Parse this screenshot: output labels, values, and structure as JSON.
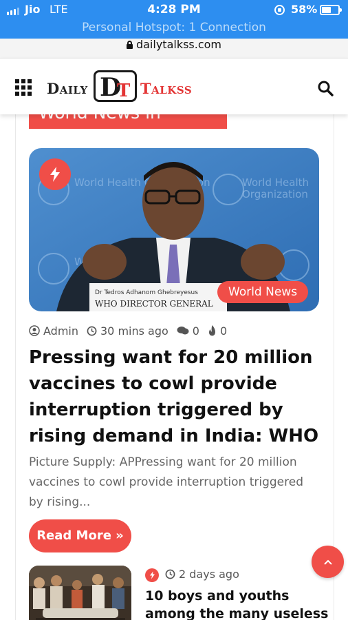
{
  "status_bar": {
    "carrier": "Jio",
    "network": "LTE",
    "time": "4:28 PM",
    "battery_percent": "58%",
    "battery_level": 0.58,
    "hotspot_text": "Personal Hotspot: 1 Connection"
  },
  "browser": {
    "url": "dailytalkss.com"
  },
  "header": {
    "logo_word_left": "Daily",
    "logo_d": "D",
    "logo_t": "T",
    "logo_word_right": "Talkss",
    "menu_icon": "grid-menu-icon",
    "search_icon": "search-icon"
  },
  "section": {
    "label": "World News in English"
  },
  "featured_post": {
    "image_caption_line1": "Dr Tedros Adhanom Ghebreyesus",
    "image_caption_line2": "WHO DIRECTOR GENERAL",
    "image_backdrop_text": "World Health Organization",
    "category": "World News",
    "author": "Admin",
    "time_ago": "30 mins ago",
    "comments": "0",
    "views": "0",
    "title": "Pressing want for 20 million vaccines to cowl provide interruption triggered by rising demand in India: WHO",
    "excerpt": "Picture Supply: APPressing want for 20 million vaccines to cowl provide interruption triggered by rising...",
    "read_more": "Read More »"
  },
  "second_post": {
    "time_ago": "2 days ago",
    "title": "10 boys and youths among the many useless"
  },
  "colors": {
    "accent": "#f04e48",
    "status_bar": "#2d8ef0"
  }
}
